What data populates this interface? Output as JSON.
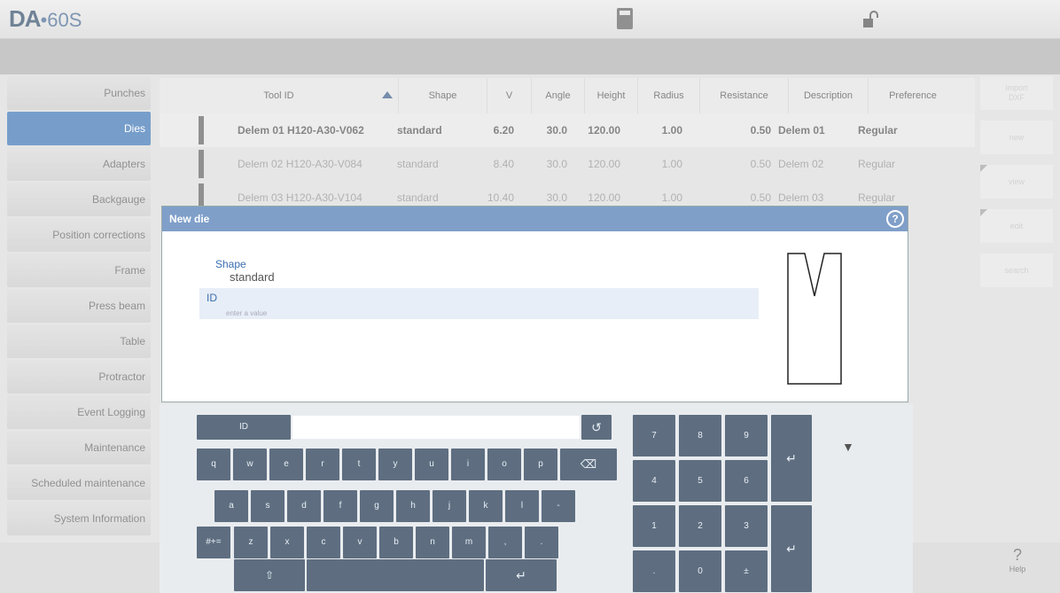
{
  "app": {
    "logo_main": "DA",
    "logo_sub": "•60S"
  },
  "sidebar": {
    "items": [
      {
        "label": "Punches",
        "active": false
      },
      {
        "label": "Dies",
        "active": true
      },
      {
        "label": "Adapters",
        "active": false
      },
      {
        "label": "Backgauge",
        "active": false
      },
      {
        "label": "Position corrections",
        "active": false
      },
      {
        "label": "Frame",
        "active": false
      },
      {
        "label": "Press beam",
        "active": false
      },
      {
        "label": "Table",
        "active": false
      },
      {
        "label": "Protractor",
        "active": false
      },
      {
        "label": "Event Logging",
        "active": false
      },
      {
        "label": "Maintenance",
        "active": false
      },
      {
        "label": "Scheduled maintenance",
        "active": false
      },
      {
        "label": "System Information",
        "active": false
      }
    ]
  },
  "table": {
    "headers": [
      "Tool ID",
      "Shape",
      "V",
      "Angle",
      "Height",
      "Radius",
      "Resistance",
      "Description",
      "Preference"
    ],
    "rows": [
      {
        "tool_id": "Delem 01 H120-A30-V062",
        "shape": "standard",
        "v": "6.20",
        "angle": "30.0",
        "height": "120.00",
        "radius": "1.00",
        "resistance": "0.50",
        "description": "Delem 01",
        "preference": "Regular"
      },
      {
        "tool_id": "Delem 02 H120-A30-V084",
        "shape": "standard",
        "v": "8.40",
        "angle": "30.0",
        "height": "120.00",
        "radius": "1.00",
        "resistance": "0.50",
        "description": "Delem 02",
        "preference": "Regular"
      },
      {
        "tool_id": "Delem 03 H120-A30-V104",
        "shape": "standard",
        "v": "10.40",
        "angle": "30.0",
        "height": "120.00",
        "radius": "1.00",
        "resistance": "0.50",
        "description": "Delem 03",
        "preference": "Regular"
      }
    ]
  },
  "right_panel": {
    "import": "import\nDXF",
    "new": "new",
    "view": "view",
    "edit": "edit",
    "search": "search"
  },
  "help": {
    "label": "Help",
    "glyph": "?"
  },
  "dialog": {
    "title": "New die",
    "shape_label": "Shape",
    "shape_value": "standard",
    "id_label": "ID",
    "id_placeholder": "enter a value"
  },
  "keyboard": {
    "field_label": "ID",
    "field_value": "",
    "row1": [
      "q",
      "w",
      "e",
      "r",
      "t",
      "y",
      "u",
      "i",
      "o",
      "p"
    ],
    "row2": [
      "a",
      "s",
      "d",
      "f",
      "g",
      "h",
      "j",
      "k",
      "l",
      "-"
    ],
    "row3": [
      "z",
      "x",
      "c",
      "v",
      "b",
      "n",
      "m",
      ",",
      "."
    ],
    "symbols_key": "#+=",
    "numpad": [
      "7",
      "8",
      "9",
      "4",
      "5",
      "6",
      "1",
      "2",
      "3",
      ".",
      "0",
      "±"
    ]
  },
  "colors": {
    "accent": "#2f6bb0",
    "dialog_header": "#7f9fc9",
    "key": "#5e6e80"
  }
}
